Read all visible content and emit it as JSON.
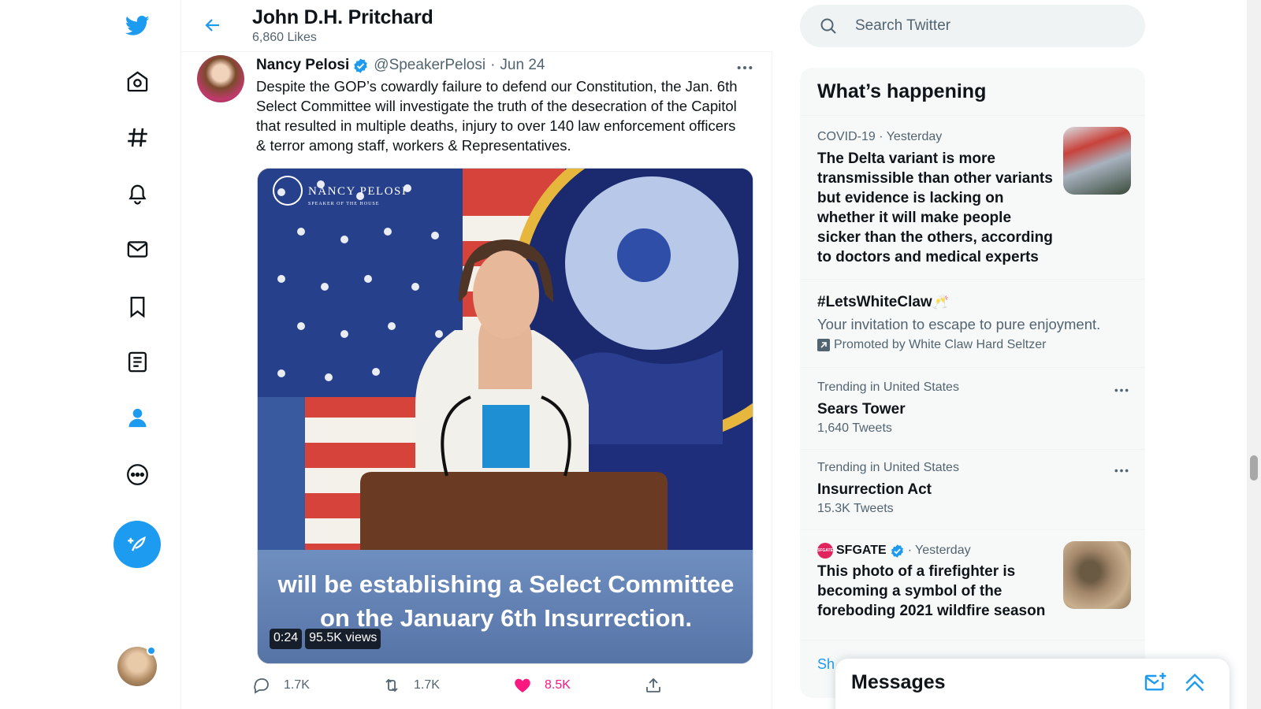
{
  "header": {
    "title": "John D.H. Pritchard",
    "subtitle": "6,860 Likes"
  },
  "tweet": {
    "name": "Nancy Pelosi",
    "handle": "@SpeakerPelosi",
    "dot": "·",
    "date": "Jun 24",
    "text": "Despite the GOP’s cowardly failure to defend our Constitution, the Jan. 6th Select Committee will investigate the truth of the desecration of the Capitol that resulted in multiple deaths, injury to over 140 law enforcement officers & terror among staff, workers & Representatives.",
    "video": {
      "watermark": "NANCY PELOSI",
      "watermark_sub": "SPEAKER OF THE HOUSE",
      "caption_line1": "will be establishing a Select Committee",
      "caption_line2": "on the January 6th Insurrection.",
      "duration": "0:24",
      "views": "95.5K views"
    },
    "stats": {
      "replies": "1.7K",
      "retweets": "1.7K",
      "likes": "8.5K"
    }
  },
  "search": {
    "placeholder": "Search Twitter"
  },
  "trends": {
    "title": "What’s happening",
    "items": [
      {
        "meta": "COVID-19 · Yesterday",
        "headline": "The Delta variant is more transmissible than other variants but evidence is lacking on whether it will make people sicker than the others, according to doctors and medical experts"
      },
      {
        "hashtag": "#LetsWhiteClaw",
        "emoji": "🥂",
        "description": "Your invitation to escape to pure enjoyment.",
        "promoted": "Promoted by White Claw Hard Seltzer"
      },
      {
        "meta": "Trending in United States",
        "name": "Sears Tower",
        "count": "1,640 Tweets"
      },
      {
        "meta": "Trending in United States",
        "name": "Insurrection Act",
        "count": "15.3K Tweets"
      },
      {
        "source": "SFGATE",
        "source_badge": "SFGATE",
        "dot": "·",
        "time": "Yesterday",
        "headline": "This photo of a firefighter is becoming a symbol of the foreboding 2021 wildfire season"
      }
    ],
    "show_more": "Sh"
  },
  "messages": {
    "title": "Messages"
  },
  "colors": {
    "accent": "#1d9bf0",
    "like": "#f91880",
    "text": "#0f1419",
    "muted": "#536471"
  }
}
